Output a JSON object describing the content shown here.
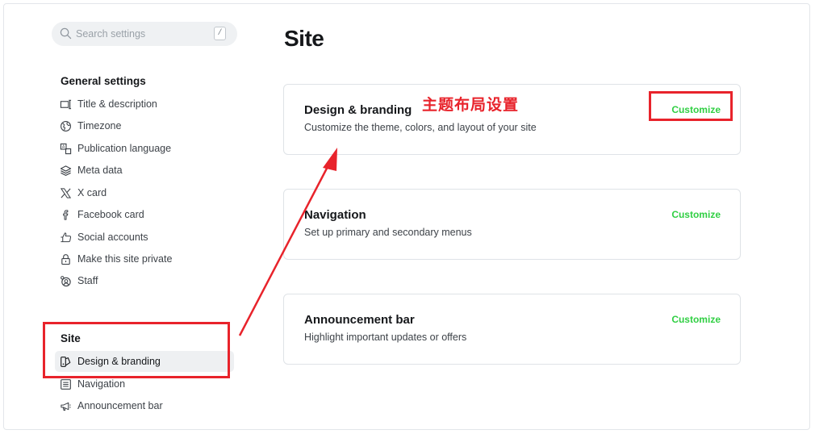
{
  "search": {
    "placeholder": "Search settings",
    "shortcut": "/"
  },
  "sidebar": {
    "general": {
      "title": "General settings",
      "items": [
        {
          "label": "Title & description",
          "icon": "title-icon"
        },
        {
          "label": "Timezone",
          "icon": "globe-icon"
        },
        {
          "label": "Publication language",
          "icon": "language-icon"
        },
        {
          "label": "Meta data",
          "icon": "layers-icon"
        },
        {
          "label": "X card",
          "icon": "x-icon"
        },
        {
          "label": "Facebook card",
          "icon": "facebook-icon"
        },
        {
          "label": "Social accounts",
          "icon": "thumbs-up-icon"
        },
        {
          "label": "Make this site private",
          "icon": "lock-icon"
        },
        {
          "label": "Staff",
          "icon": "staff-icon"
        }
      ]
    },
    "site": {
      "title": "Site",
      "items": [
        {
          "label": "Design & branding",
          "icon": "brush-icon",
          "active": true
        },
        {
          "label": "Navigation",
          "icon": "menu-icon"
        },
        {
          "label": "Announcement bar",
          "icon": "megaphone-icon"
        }
      ]
    }
  },
  "main": {
    "title": "Site",
    "cards": [
      {
        "title": "Design & branding",
        "description": "Customize the theme, colors, and layout of your site",
        "action": "Customize"
      },
      {
        "title": "Navigation",
        "description": "Set up primary and secondary menus",
        "action": "Customize"
      },
      {
        "title": "Announcement bar",
        "description": "Highlight important updates or offers",
        "action": "Customize"
      }
    ]
  },
  "annotation": {
    "label": "主题布局设置",
    "color": "#e8232b"
  },
  "colors": {
    "accent": "#30cf43",
    "annotation": "#e8232b",
    "active_bg": "#eef0f2"
  }
}
